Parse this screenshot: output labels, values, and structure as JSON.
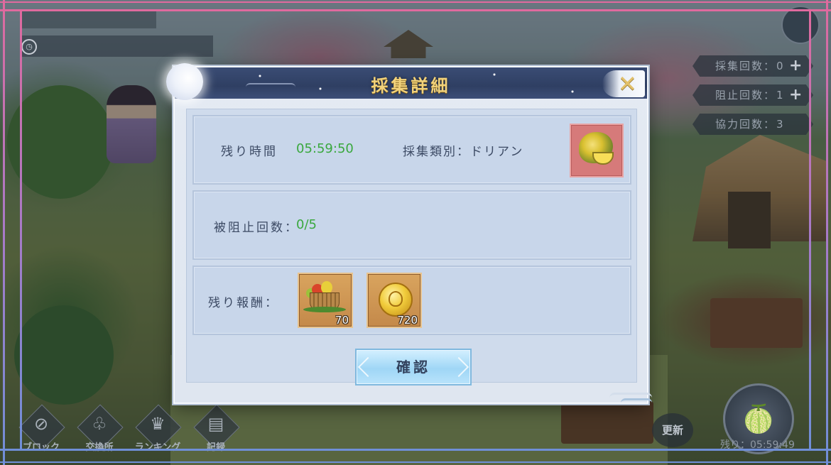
{
  "dialog": {
    "title": "採集詳細",
    "close_symbol": "✕",
    "time_label": "残り時間",
    "time_value": "05:59:50",
    "category_label": "採集類別：ドリアン",
    "category_icon": "durian-icon",
    "blocked_label": "被阻止回数：",
    "blocked_value": "0/5",
    "reward_label": "残り報酬：",
    "rewards": [
      {
        "icon": "fruit-basket-icon",
        "count": "70"
      },
      {
        "icon": "gold-coin-icon",
        "count": "720"
      }
    ],
    "confirm_label": "確認"
  },
  "hud": {
    "counters": [
      {
        "label": "採集回数：",
        "value": "0",
        "plus": "+"
      },
      {
        "label": "阻止回数：",
        "value": "1",
        "plus": "+"
      },
      {
        "label": "協力回数：",
        "value": "3",
        "plus": ""
      }
    ],
    "nav": [
      {
        "label": "ブロック",
        "icon": "ban-icon"
      },
      {
        "label": "交換所",
        "icon": "exchange-icon"
      },
      {
        "label": "ランキング",
        "icon": "trophy-icon"
      },
      {
        "label": "記録",
        "icon": "record-icon"
      }
    ],
    "refresh_label": "更新",
    "remaining_bottom": "残り：05:59:49"
  },
  "colors": {
    "title_gold": "#f2d27a",
    "value_green": "#3aa83e",
    "frame_pink": "#e06a9e",
    "frame_blue": "#6f8fd8"
  }
}
